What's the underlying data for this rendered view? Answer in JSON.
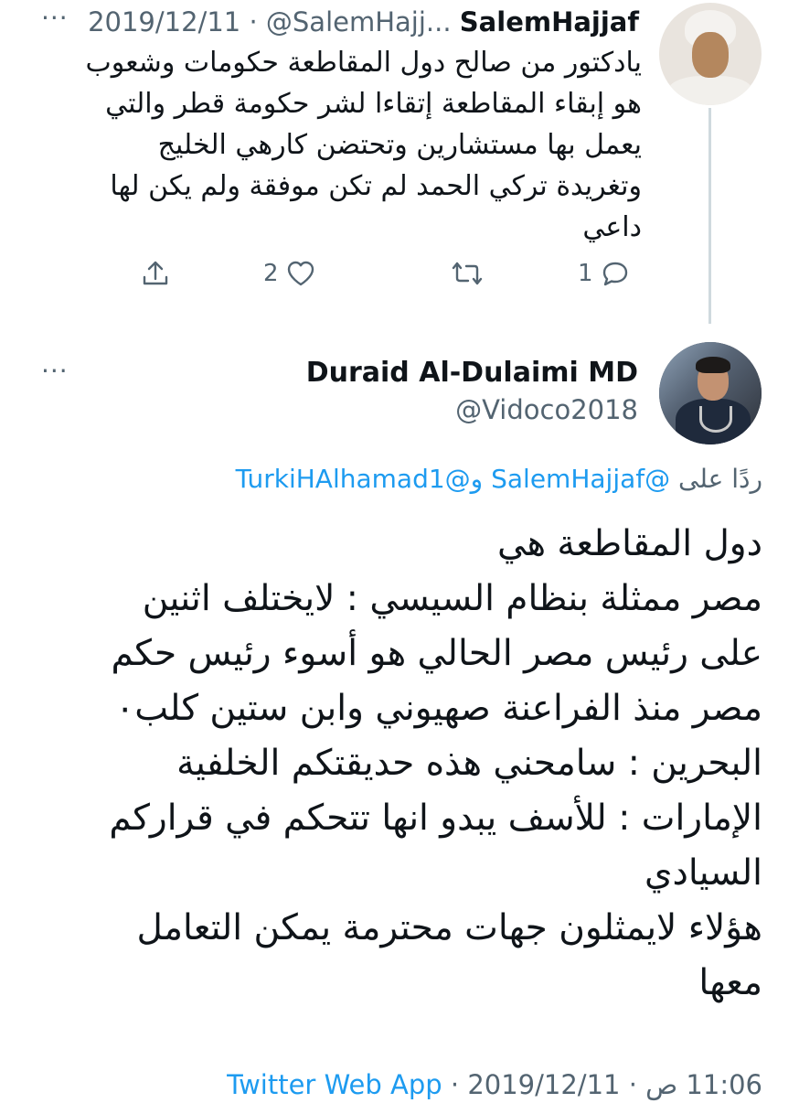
{
  "parent_tweet": {
    "display_name": "SalemHajjaf",
    "handle": "@SalemHajj...",
    "separator": "·",
    "date": "2019/12/11",
    "more": "···",
    "text": "يادكتور من صالح دول المقاطعة حكومات وشعوب\nهو إبقاء المقاطعة إتقاءا لشر حكومة قطر والتي\nيعمل بها مستشارين وتحتضن كارهي الخليج\nوتغريدة تركي الحمد لم تكن موفقة ولم يكن لها\nداعي",
    "reply_count": "1",
    "like_count": "2"
  },
  "main_tweet": {
    "display_name": "Duraid Al-Dulaimi MD",
    "handle": "@Vidoco2018",
    "more": "···",
    "replying_prefix": "ردًا على",
    "reply_user_1": "@SalemHajjaf",
    "reply_conjunction": "و",
    "reply_user_2": "@TurkiHAlhamad1",
    "text": "دول المقاطعة هي\nمصر ممثلة بنظام السيسي : لايختلف اثنين\nعلى رئيس مصر الحالي هو أسوء رئيس حكم\nمصر منذ الفراعنة صهيوني وابن ستين كلب٠\nالبحرين : سامحني هذه حديقتكم الخلفية\nالإمارات : للأسف يبدو انها تتحكم في قراركم\nالسيادي\nهؤلاء لايمثلون جهات محترمة يمكن التعامل\nمعها",
    "time": "11:06 ص",
    "separator": "·",
    "date": "2019/12/11",
    "source": "Twitter Web App"
  },
  "colors": {
    "text": "#0f1419",
    "muted": "#536471",
    "link": "#1d9bf0",
    "thread_line": "#cfd9de"
  },
  "icons": [
    "reply-icon",
    "retweet-icon",
    "like-icon",
    "share-icon",
    "more-icon"
  ]
}
